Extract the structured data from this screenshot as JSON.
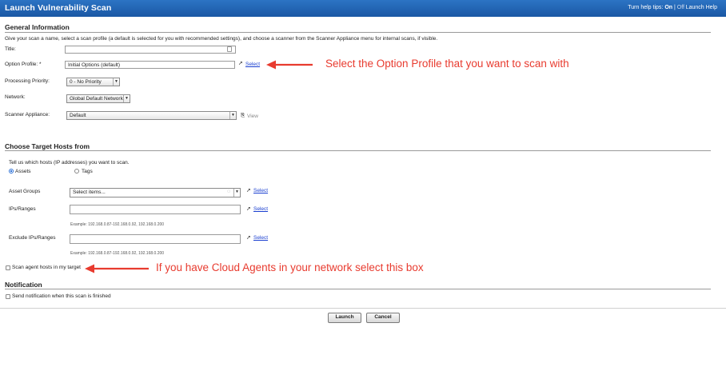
{
  "header": {
    "title": "Launch Vulnerability Scan",
    "help_tips_prefix": "Turn help tips:",
    "help_tips_on": "On",
    "help_tips_sep": "|",
    "help_tips_off": "Off",
    "help_link": "Launch Help"
  },
  "general": {
    "heading": "General Information",
    "description": "Give your scan a name, select a scan profile (a default is selected for you with recommended settings), and choose a scanner from the Scanner Appliance menu for internal scans, if visible.",
    "title_label": "Title:",
    "title_value": "",
    "option_profile_label": "Option Profile: *",
    "option_profile_value": "Initial Options (default)",
    "option_profile_select": "Select",
    "processing_priority_label": "Processing Priority:",
    "processing_priority_value": "0 - No Priority",
    "network_label": "Network:",
    "network_value": "Global Default Network",
    "scanner_label": "Scanner Appliance:",
    "scanner_value": "Default",
    "scanner_view": "View"
  },
  "targets": {
    "heading": "Choose Target Hosts from",
    "description": "Tell us which hosts (IP addresses) you want to scan.",
    "radio_assets": "Assets",
    "radio_tags": "Tags",
    "asset_groups_label": "Asset Groups",
    "asset_groups_placeholder": "Select items...",
    "asset_groups_select": "Select",
    "ips_label": "IPs/Ranges",
    "ips_select": "Select",
    "ips_example": "Example: 192.168.0.87-192.168.0.92, 192.168.0.200",
    "exclude_label": "Exclude IPs/Ranges",
    "exclude_select": "Select",
    "exclude_example": "Example: 192.168.0.87-192.168.0.92, 192.168.0.200",
    "cloud_agents_label": "Scan agent hosts in my target"
  },
  "notification": {
    "heading": "Notification",
    "send_label": "Send notification when this scan is finished"
  },
  "footer": {
    "launch": "Launch",
    "cancel": "Cancel"
  },
  "annotations": {
    "option_profile_note": "Select the Option Profile that you want to scan with",
    "cloud_agents_note": "If you have Cloud Agents in your network select this box",
    "color": "#e83b2f"
  },
  "colors": {
    "header_bg": "#1f62b4",
    "link": "#1a3fd0"
  }
}
